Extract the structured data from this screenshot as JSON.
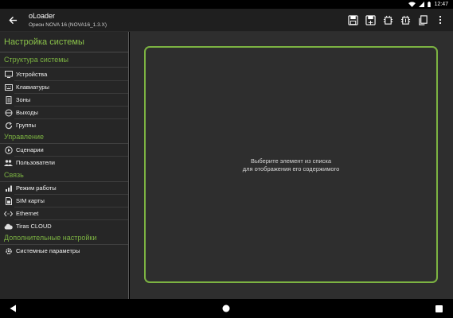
{
  "status_bar": {
    "time": "12:47"
  },
  "app_bar": {
    "title": "oLoader",
    "subtitle": "Орион NOVA 16 (NOVA16_1.3.X)"
  },
  "sidebar": {
    "title": "Настройка системы",
    "sections": [
      {
        "header": "Структура системы",
        "items": [
          {
            "label": "Устройства",
            "icon": "devices-icon"
          },
          {
            "label": "Клавиатуры",
            "icon": "keyboard-icon"
          },
          {
            "label": "Зоны",
            "icon": "zones-icon"
          },
          {
            "label": "Выходы",
            "icon": "outputs-icon"
          },
          {
            "label": "Группы",
            "icon": "groups-icon"
          }
        ]
      },
      {
        "header": "Управление",
        "items": [
          {
            "label": "Сценарии",
            "icon": "play-circle-icon"
          },
          {
            "label": "Пользователи",
            "icon": "users-icon"
          }
        ]
      },
      {
        "header": "Связь",
        "items": [
          {
            "label": "Режим работы",
            "icon": "signal-icon"
          },
          {
            "label": "SIM карты",
            "icon": "sim-card-icon"
          },
          {
            "label": "Ethernet",
            "icon": "ethernet-icon"
          },
          {
            "label": "Tiras CLOUD",
            "icon": "cloud-icon"
          }
        ]
      },
      {
        "header": "Дополнительные настройки",
        "items": [
          {
            "label": "Системные параметры",
            "icon": "gear-icon"
          }
        ]
      }
    ]
  },
  "content": {
    "placeholder_line1": "Выберите элемент из списка",
    "placeholder_line2": "для отображения его содержимого"
  },
  "colors": {
    "accent": "#7cb342",
    "sidebar_bg": "#262626",
    "content_bg": "#2e2e2e",
    "app_bar_bg": "#1f1f1f"
  }
}
